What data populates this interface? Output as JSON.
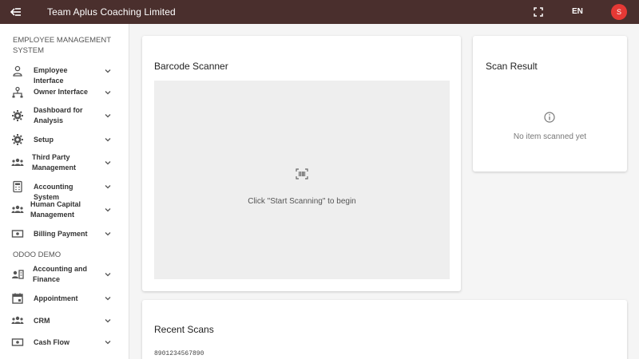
{
  "header": {
    "title": "Team Aplus Coaching Limited",
    "language": "EN",
    "avatar_initial": "S",
    "menu_icon": "menu-collapse-icon",
    "fullscreen_icon": "fullscreen-icon"
  },
  "sidebar": {
    "sections": [
      {
        "title": "EMPLOYEE MANAGEMENT SYSTEM",
        "items": [
          {
            "label": "Employee Interface",
            "icon": "person-icon"
          },
          {
            "label": "Owner Interface",
            "icon": "org-chart-icon"
          },
          {
            "label": "Dashboard for Analysis",
            "icon": "gear-icon"
          },
          {
            "label": "Setup",
            "icon": "gear-icon"
          },
          {
            "label": "Third Party Management",
            "icon": "people-icon"
          },
          {
            "label": "Accounting System",
            "icon": "calculator-icon"
          },
          {
            "label": "Human Capital Management",
            "icon": "people-icon"
          },
          {
            "label": "Billing Payment",
            "icon": "cash-icon"
          }
        ]
      },
      {
        "title": "ODOO DEMO",
        "items": [
          {
            "label": "Accounting and Finance",
            "icon": "account-box-icon"
          },
          {
            "label": "Appointment",
            "icon": "calendar-icon"
          },
          {
            "label": "CRM",
            "icon": "people-icon"
          },
          {
            "label": "Cash Flow",
            "icon": "cash-icon"
          }
        ]
      }
    ]
  },
  "scanner": {
    "title": "Barcode Scanner",
    "hint": "Click \"Start Scanning\" to begin"
  },
  "result": {
    "title": "Scan Result",
    "empty_text": "No item scanned yet"
  },
  "recent": {
    "title": "Recent Scans",
    "items": [
      "8901234567890"
    ]
  },
  "colors": {
    "topbar": "#4a2f2d",
    "avatar": "#e53935",
    "scanner_bg": "#eeeeee"
  }
}
